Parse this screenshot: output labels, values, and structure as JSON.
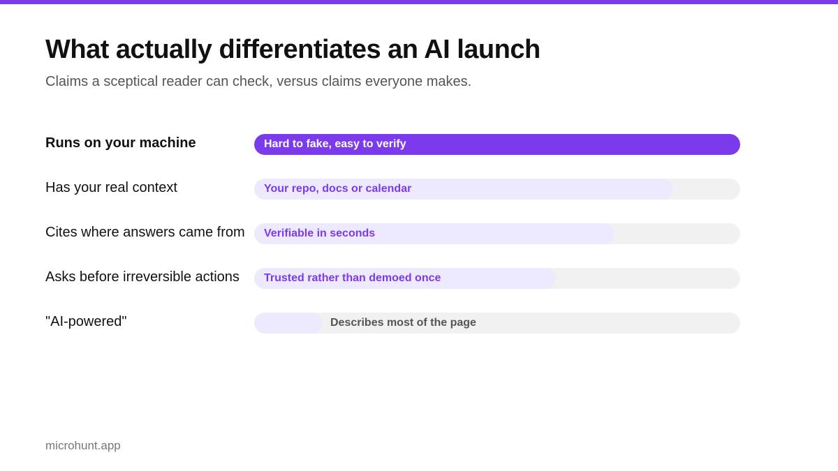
{
  "header": {
    "title": "What actually differentiates an AI launch",
    "subtitle": "Claims a sceptical reader can check, versus claims everyone makes."
  },
  "chart_data": {
    "type": "bar",
    "orientation": "horizontal",
    "categories": [
      "Runs on your machine",
      "Has your real context",
      "Cites where answers came from",
      "Asks before irreversible actions",
      "\"AI-powered\""
    ],
    "values": [
      100,
      86,
      74,
      62,
      14
    ],
    "xlim": [
      0,
      100
    ],
    "bar_labels": [
      "Hard to fake, easy to verify",
      "Your repo, docs or calendar",
      "Verifiable in seconds",
      "Trusted rather than demoed once",
      "Describes most of the page"
    ],
    "grid": false,
    "legend": "none",
    "highlight_index": 0,
    "colors": {
      "highlight_fill": "#7c3aed",
      "fill": "#ede9fe",
      "track": "#f1f1f1",
      "highlight_text": "#ffffff",
      "text": "#7c3aed",
      "muted_text": "#555555"
    }
  },
  "footer": {
    "brand": "microhunt.app"
  },
  "colors": {
    "accent": "#7c3aed"
  }
}
